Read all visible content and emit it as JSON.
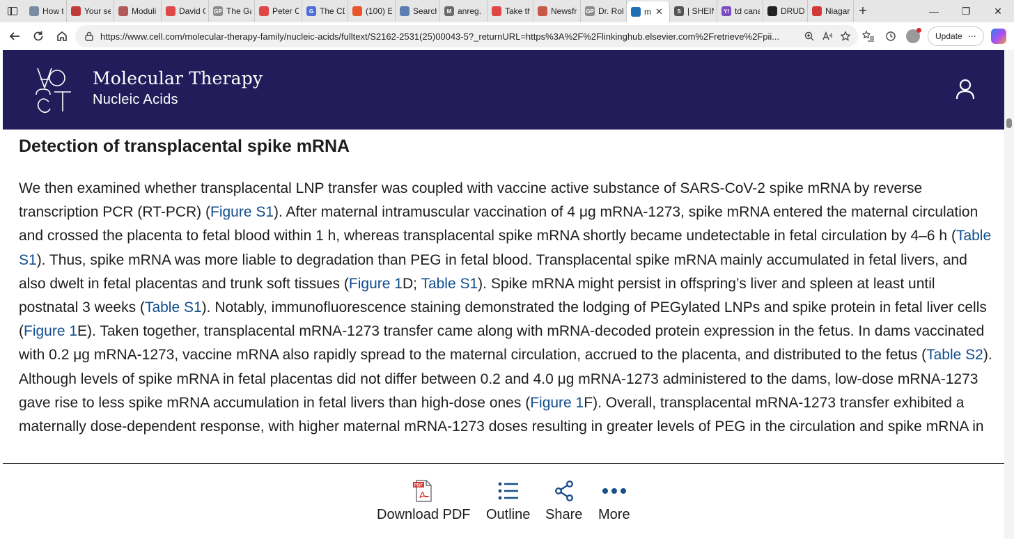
{
  "browser": {
    "tabs": [
      {
        "title": "How to",
        "favicon_color": "#7a8ca3"
      },
      {
        "title": "Your se",
        "favicon_color": "#c23b3b"
      },
      {
        "title": "Moduli",
        "favicon_color": "#b05a5a"
      },
      {
        "title": "David C",
        "favicon_color": "#e04848"
      },
      {
        "title": "The Ga",
        "favicon_color": "#8c8c8c"
      },
      {
        "title": "Peter C",
        "favicon_color": "#e04848"
      },
      {
        "title": "The CD",
        "favicon_color": "#4a6fd8"
      },
      {
        "title": "(100) E",
        "favicon_color": "#e8552a"
      },
      {
        "title": "Search",
        "favicon_color": "#5a7fb0"
      },
      {
        "title": "anreg.",
        "favicon_color": "#6a6a6a"
      },
      {
        "title": "Take th",
        "favicon_color": "#e04848"
      },
      {
        "title": "Newsfr",
        "favicon_color": "#c8584a"
      },
      {
        "title": "Dr. Rol",
        "favicon_color": "#8c8c8c"
      },
      {
        "title": "m",
        "favicon_color": "#1f6fb5",
        "active": true
      },
      {
        "title": "| SHEIN",
        "favicon_color": "#555555"
      },
      {
        "title": "td cana",
        "favicon_color": "#7a4cc0"
      },
      {
        "title": "DRUDG",
        "favicon_color": "#222222"
      },
      {
        "title": "Niagar",
        "favicon_color": "#d23a3a"
      }
    ],
    "favicon_letters": {
      "Moduli": "",
      "The Ga": "GP",
      "The CD": "G",
      "anreg.": "M",
      "Dr. Rol": "GP",
      "| SHEIN": "S",
      "td cana": "Y!"
    },
    "active_tab_close": "✕",
    "new_tab_label": "+",
    "window_controls": [
      "—",
      "❐",
      "✕"
    ],
    "url": "https://www.cell.com/molecular-therapy-family/nucleic-acids/fulltext/S2162-2531(25)00043-5?_returnURL=https%3A%2F%2Flinkinghub.elsevier.com%2Fretrieve%2Fpii...",
    "update_label": "Update",
    "update_more": "⋯"
  },
  "header": {
    "journal_title": "Molecular Therapy",
    "journal_subtitle": "Nucleic Acids",
    "logo_letters": [
      "A",
      "S",
      "G",
      "C",
      "T"
    ],
    "colors": {
      "header_bg": "#221c5a",
      "link": "#0f4c8f"
    }
  },
  "article": {
    "section_heading": "Detection of transplacental spike mRNA",
    "paragraph": [
      {
        "t": "We then examined whether transplacental LNP transfer was coupled with vaccine active substance of SARS-CoV-2 spike mRNA by reverse transcription PCR (RT-PCR) ("
      },
      {
        "t": "Figure S1",
        "link": true
      },
      {
        "t": "). After maternal intramuscular vaccination of 4 μg mRNA-1273, spike mRNA entered the maternal circulation and crossed the placenta to fetal blood within 1 h, whereas transplacental spike mRNA shortly became undetectable in fetal circulation by 4–6 h ("
      },
      {
        "t": "Table S1",
        "link": true
      },
      {
        "t": "). Thus, spike mRNA was more liable to degradation than PEG in fetal blood. Transplacental spike mRNA mainly accumulated in fetal livers, and also dwelt in fetal placentas and trunk soft tissues ("
      },
      {
        "t": "Figure 1",
        "link": true
      },
      {
        "t": "D; "
      },
      {
        "t": "Table S1",
        "link": true
      },
      {
        "t": "). Spike mRNA might persist in offspring’s liver and spleen at least until postnatal 3 weeks ("
      },
      {
        "t": "Table S1",
        "link": true
      },
      {
        "t": "). Notably, immunofluorescence staining demonstrated the lodging of PEGylated LNPs and spike protein in fetal liver cells ("
      },
      {
        "t": "Figure 1",
        "link": true
      },
      {
        "t": "E). Taken together, transplacental mRNA-1273 transfer came along with mRNA-decoded protein expression in the fetus. In dams vaccinated with 0.2 μg mRNA-1273, vaccine mRNA also rapidly spread to the maternal circulation, accrued to the placenta, and distributed to the fetus ("
      },
      {
        "t": "Table S2",
        "link": true
      },
      {
        "t": "). Although levels of spike mRNA in fetal placentas did not differ between 0.2 and 4.0 μg mRNA-1273 administered to the dams, low-dose mRNA-1273 gave rise to less spike mRNA accumulation in fetal livers than high-dose ones ("
      },
      {
        "t": "Figure 1",
        "link": true
      },
      {
        "t": "F). Overall, transplacental mRNA-1273 transfer exhibited a maternally dose-dependent response, with higher maternal mRNA-1273 doses resulting in greater levels of PEG in the circulation and spike mRNA in"
      }
    ]
  },
  "bottom_bar": {
    "download_pdf": "Download PDF",
    "pdf_badge": "PDF",
    "outline": "Outline",
    "share": "Share",
    "more": "More"
  }
}
